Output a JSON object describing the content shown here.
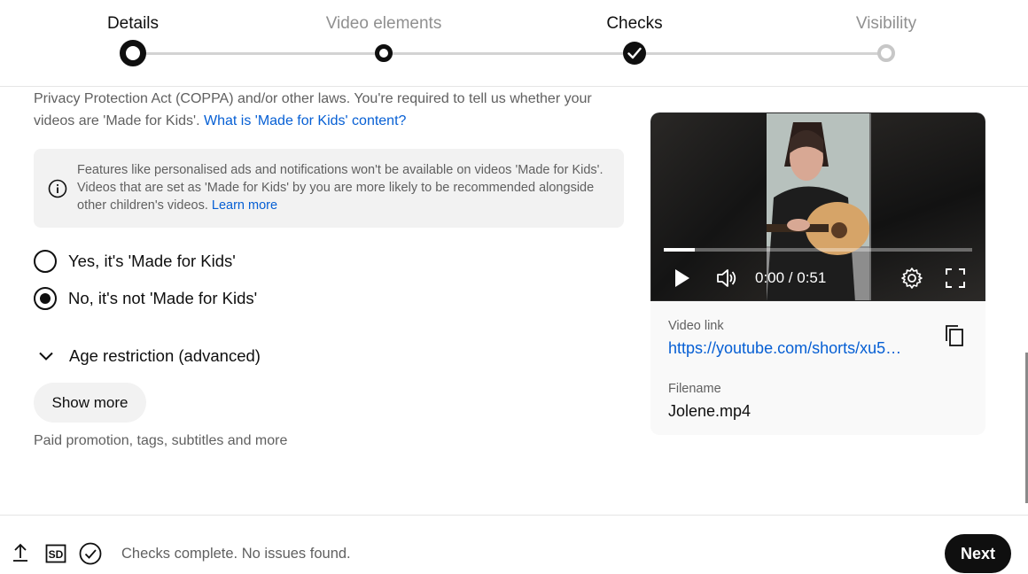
{
  "stepper": {
    "steps": [
      {
        "label": "Details",
        "state": "current"
      },
      {
        "label": "Video elements",
        "state": "done"
      },
      {
        "label": "Checks",
        "state": "checked"
      },
      {
        "label": "Visibility",
        "state": "upcoming"
      }
    ]
  },
  "audience": {
    "intro_text": "Privacy Protection Act (COPPA) and/or other laws. You're required to tell us whether your videos are 'Made for Kids'. ",
    "intro_link": "What is 'Made for Kids' content?",
    "notice_text": "Features like personalised ads and notifications won't be available on videos 'Made for Kids'. Videos that are set as 'Made for Kids' by you are more likely to be recommended alongside other children's videos. ",
    "notice_link": "Learn more",
    "options": [
      {
        "label": "Yes, it's 'Made for Kids'",
        "selected": false
      },
      {
        "label": "No, it's not 'Made for Kids'",
        "selected": true
      }
    ],
    "age_restriction_label": "Age restriction (advanced)"
  },
  "more": {
    "show_more_label": "Show more",
    "hint": "Paid promotion, tags, subtitles and more"
  },
  "preview": {
    "time": "0:00 / 0:51",
    "progress_fraction": 0.1,
    "video_link_label": "Video link",
    "video_link": "https://youtube.com/shorts/xu5…",
    "filename_label": "Filename",
    "filename": "Jolene.mp4"
  },
  "footer": {
    "status": "Checks complete. No issues found.",
    "next_label": "Next",
    "sd_badge": "SD"
  }
}
